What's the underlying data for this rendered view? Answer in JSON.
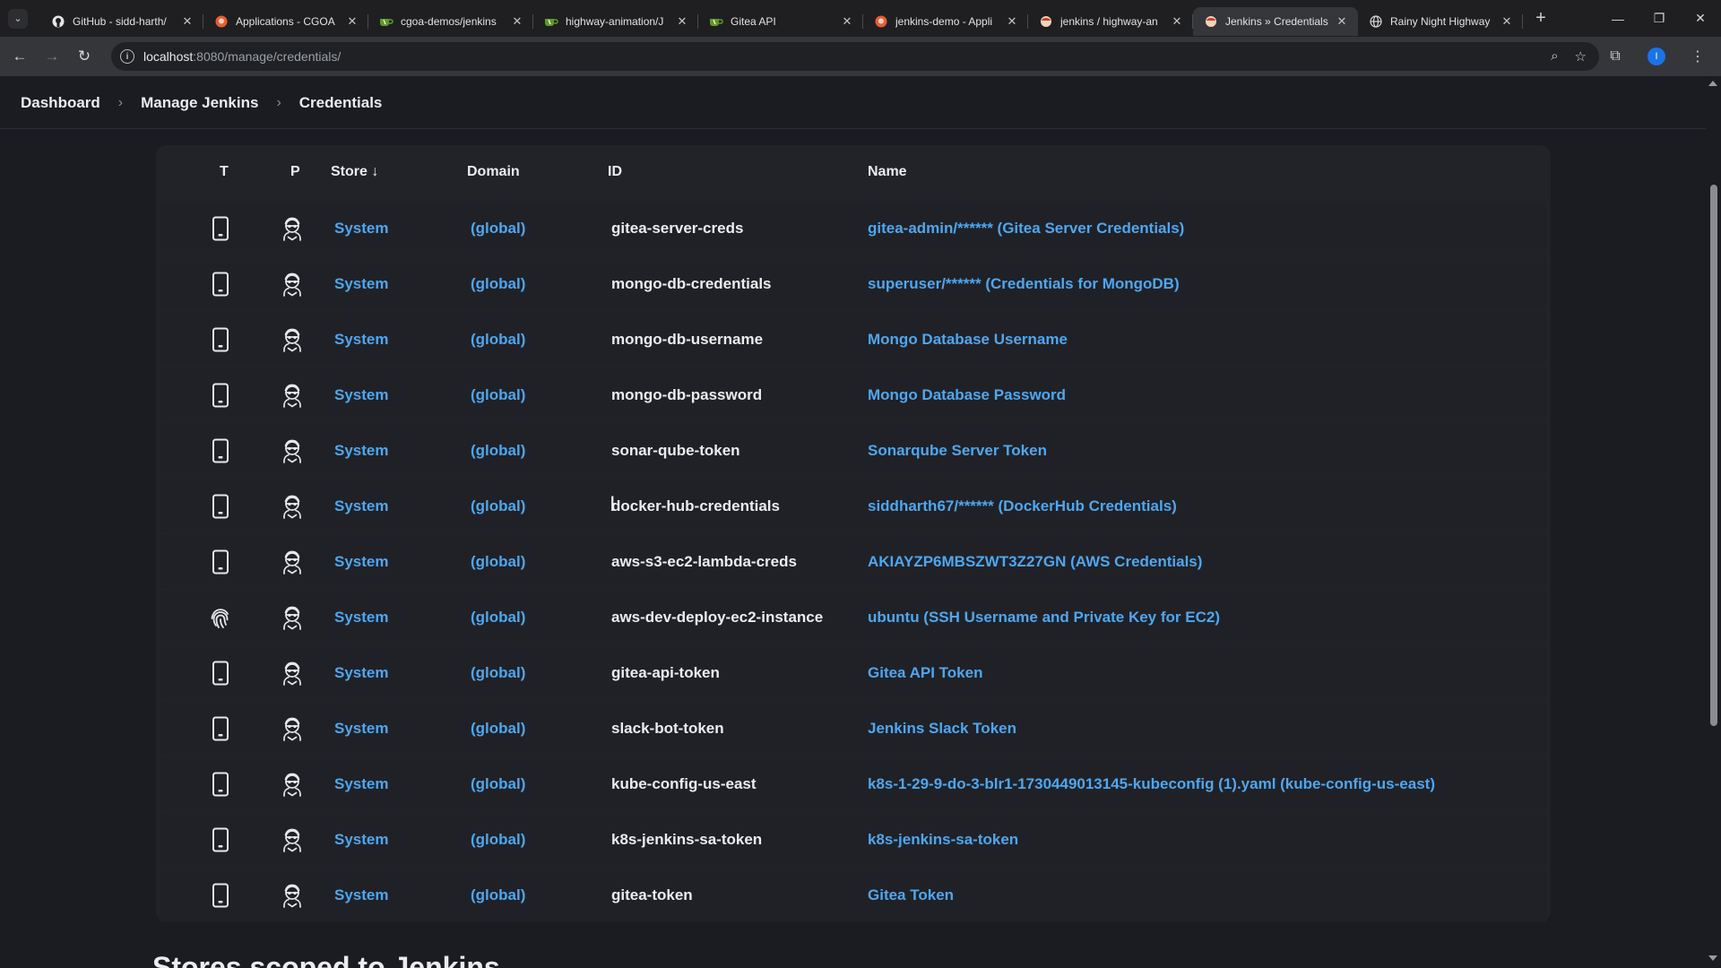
{
  "browser": {
    "tabs": [
      {
        "title": "GitHub - sidd-harth/",
        "favicon": "github-icon"
      },
      {
        "title": "Applications - CGOA",
        "favicon": "argo-icon"
      },
      {
        "title": "cgoa-demos/jenkins",
        "favicon": "gitea-icon"
      },
      {
        "title": "highway-animation/J",
        "favicon": "gitea-icon"
      },
      {
        "title": "Gitea API",
        "favicon": "gitea-icon"
      },
      {
        "title": "jenkins-demo - Appli",
        "favicon": "argo-icon"
      },
      {
        "title": "jenkins / highway-an",
        "favicon": "jenkins-icon"
      },
      {
        "title": "Jenkins » Credentials",
        "favicon": "jenkins-icon",
        "active": true
      },
      {
        "title": "Rainy Night Highway",
        "favicon": "globe-icon"
      }
    ],
    "url_host": "localhost",
    "url_path": ":8080/manage/credentials/",
    "profile_initial": "I"
  },
  "breadcrumbs": [
    "Dashboard",
    "Manage Jenkins",
    "Credentials"
  ],
  "table": {
    "headers": {
      "t": "T",
      "p": "P",
      "store": "Store ↓",
      "domain": "Domain",
      "id": "ID",
      "name": "Name"
    },
    "rows": [
      {
        "type_icon": "phone-icon",
        "store": "System",
        "domain": "(global)",
        "id": "gitea-server-creds",
        "name": "gitea-admin/****** (Gitea Server Credentials)"
      },
      {
        "type_icon": "phone-icon",
        "store": "System",
        "domain": "(global)",
        "id": "mongo-db-credentials",
        "name": "superuser/****** (Credentials for MongoDB)"
      },
      {
        "type_icon": "phone-icon",
        "store": "System",
        "domain": "(global)",
        "id": "mongo-db-username",
        "name": "Mongo Database Username"
      },
      {
        "type_icon": "phone-icon",
        "store": "System",
        "domain": "(global)",
        "id": "mongo-db-password",
        "name": "Mongo Database Password"
      },
      {
        "type_icon": "phone-icon",
        "store": "System",
        "domain": "(global)",
        "id": "sonar-qube-token",
        "name": "Sonarqube Server Token"
      },
      {
        "type_icon": "phone-icon",
        "store": "System",
        "domain": "(global)",
        "id": "docker-hub-credentials",
        "name": "siddharth67/****** (DockerHub Credentials)"
      },
      {
        "type_icon": "phone-icon",
        "store": "System",
        "domain": "(global)",
        "id": "aws-s3-ec2-lambda-creds",
        "name": "AKIAYZP6MBSZWT3Z27GN (AWS Credentials)"
      },
      {
        "type_icon": "fingerprint-icon",
        "store": "System",
        "domain": "(global)",
        "id": "aws-dev-deploy-ec2-instance",
        "name": "ubuntu (SSH Username and Private Key for EC2)"
      },
      {
        "type_icon": "phone-icon",
        "store": "System",
        "domain": "(global)",
        "id": "gitea-api-token",
        "name": "Gitea API Token"
      },
      {
        "type_icon": "phone-icon",
        "store": "System",
        "domain": "(global)",
        "id": "slack-bot-token",
        "name": "Jenkins Slack Token"
      },
      {
        "type_icon": "phone-icon",
        "store": "System",
        "domain": "(global)",
        "id": "kube-config-us-east",
        "name": "k8s-1-29-9-do-3-blr1-1730449013145-kubeconfig (1).yaml (kube-config-us-east)"
      },
      {
        "type_icon": "phone-icon",
        "store": "System",
        "domain": "(global)",
        "id": "k8s-jenkins-sa-token",
        "name": "k8s-jenkins-sa-token"
      },
      {
        "type_icon": "phone-icon",
        "store": "System",
        "domain": "(global)",
        "id": "gitea-token",
        "name": "Gitea Token"
      }
    ]
  },
  "next_section_title": "Stores scoped to Jenkins",
  "colors": {
    "link": "#4ea7f0",
    "background": "#1b1c22",
    "panel": "#222329"
  }
}
